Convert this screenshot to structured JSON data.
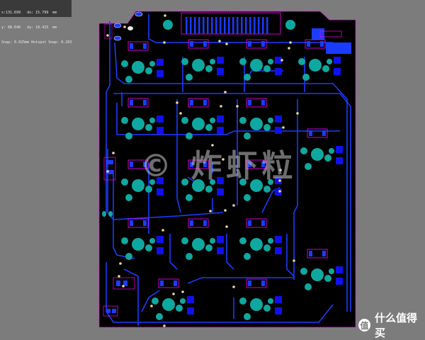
{
  "readout": {
    "line1": "x:131.699   dx: 15.799  mm",
    "line2": "y: 88.646   dy: 18.415  mm",
    "line3": "Snap: 0.025mm Hotspot Snap: 0.203mm"
  },
  "watermark": "© 炸虾粒",
  "brand": {
    "logo_glyph": "值",
    "text": "什么值得买"
  },
  "colors": {
    "canvas": "#7c7c7c",
    "board": "#000000",
    "outline": "#ff00ff",
    "trace": "#1a3cff",
    "pad": "#1010ee",
    "copper": "#0fa8a0",
    "silkscreen": "#ff00ff",
    "via": "#e8d898"
  }
}
